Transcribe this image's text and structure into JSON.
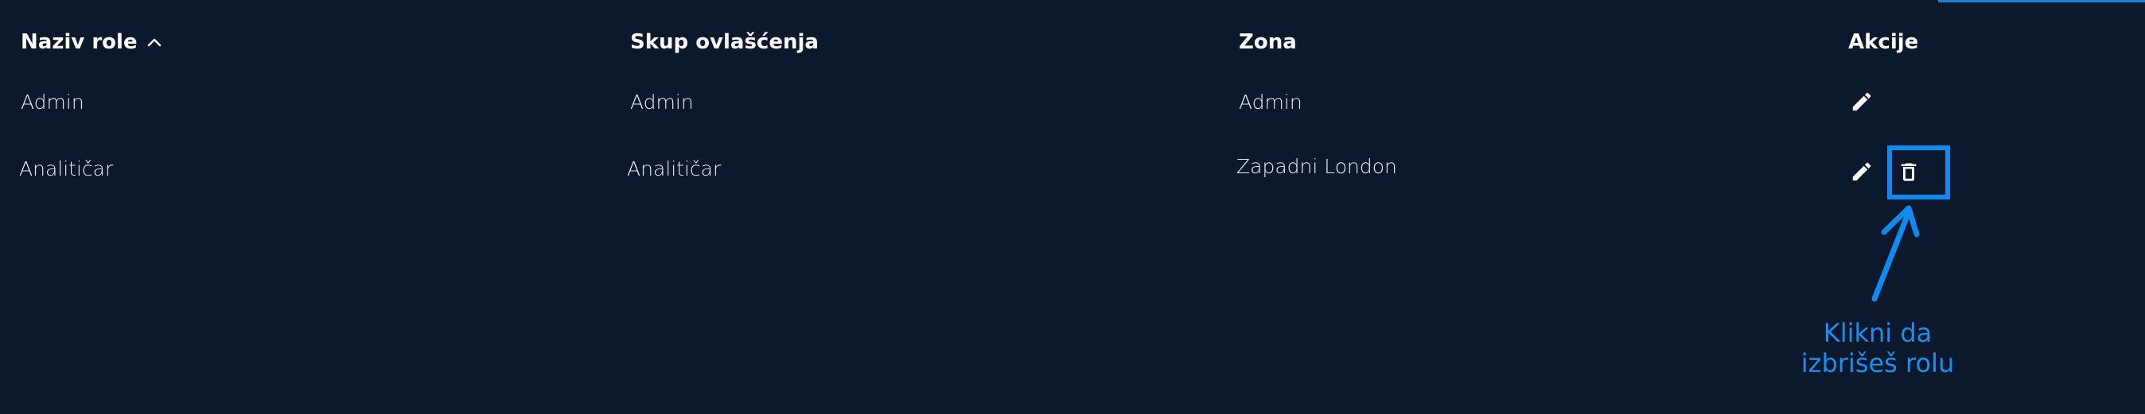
{
  "table": {
    "headers": {
      "role_name": "Naziv role",
      "permission_set": "Skup ovlašćenja",
      "zone": "Zona",
      "actions": "Akcije"
    },
    "rows": [
      {
        "role_name": "Admin",
        "permission_set": "Admin",
        "zone": "Admin"
      },
      {
        "role_name": "Analitičar",
        "permission_set": "Analitičar",
        "zone": "Zapadni London"
      }
    ]
  },
  "annotation": {
    "line1": "Klikni da",
    "line2": "izbrišeš rolu",
    "color": "#1a8ff0"
  },
  "icons": {
    "sort": "chevron-up-icon",
    "edit": "pencil-icon",
    "delete": "trash-icon"
  }
}
